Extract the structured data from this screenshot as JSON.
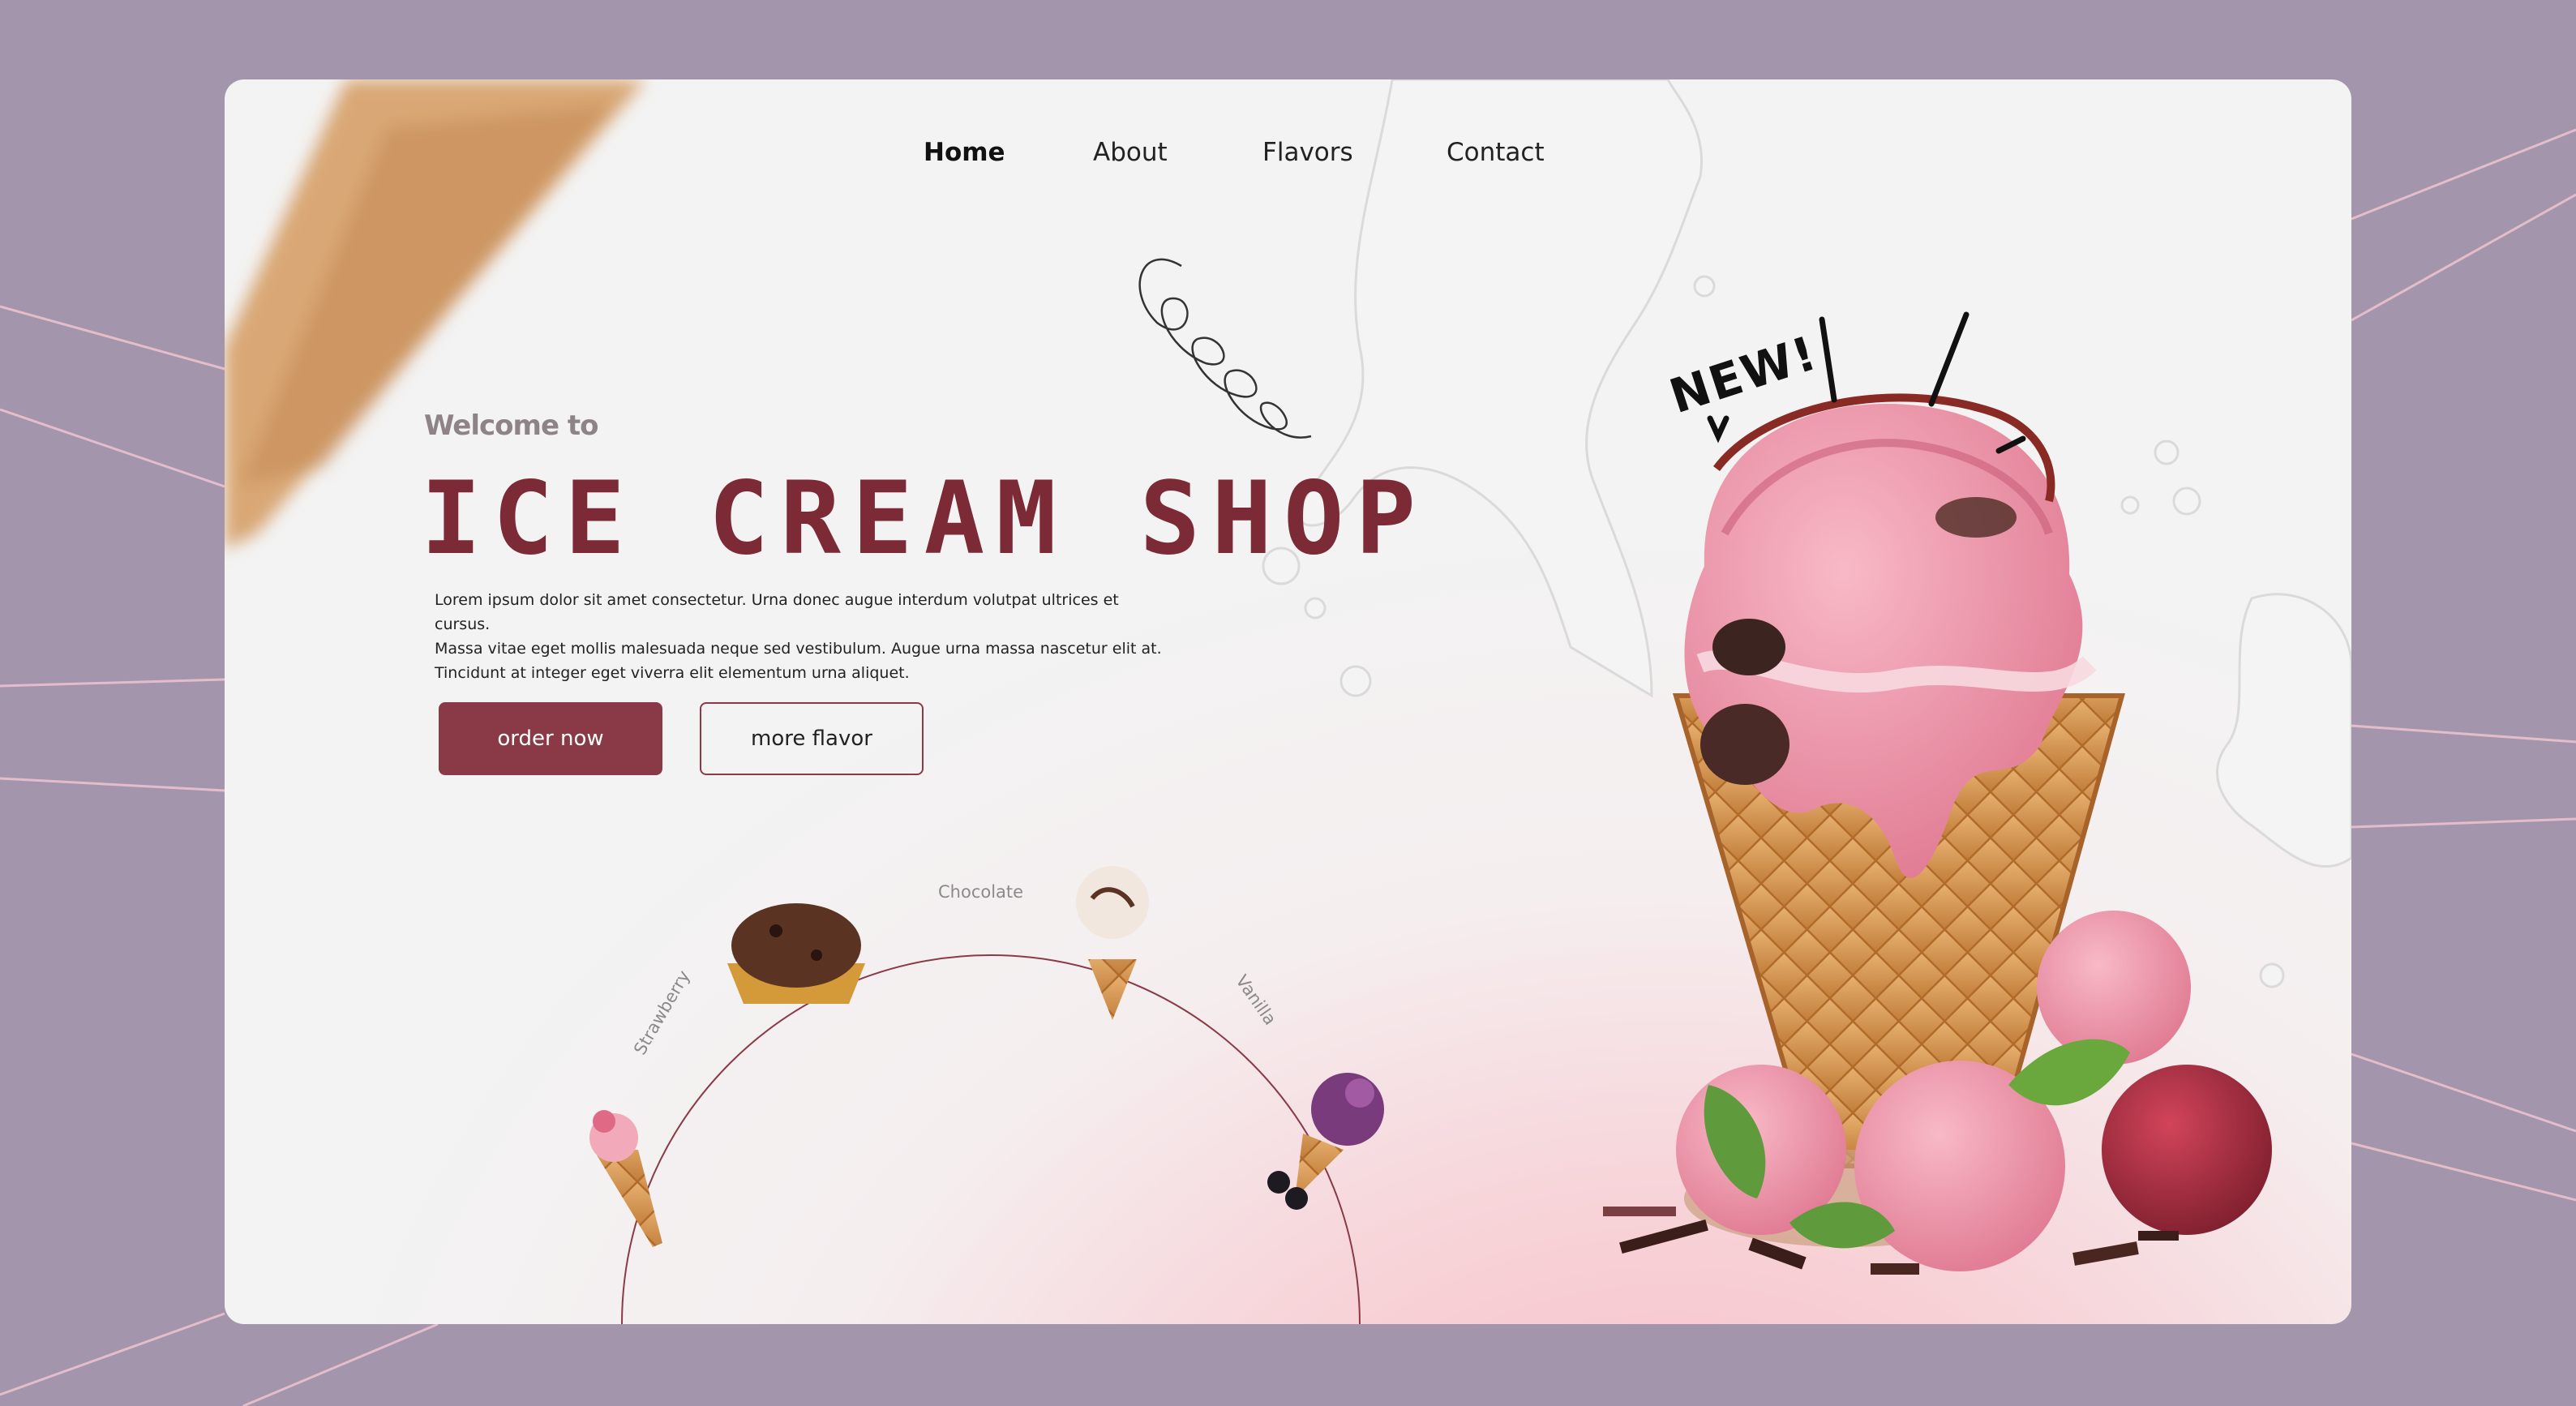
{
  "nav": {
    "items": [
      {
        "label": "Home",
        "active": true
      },
      {
        "label": "About",
        "active": false
      },
      {
        "label": "Flavors",
        "active": false
      },
      {
        "label": "Contact",
        "active": false
      }
    ]
  },
  "hero": {
    "welcome": "Welcome to",
    "title": "ICE CREAM SHOP",
    "description_lines": [
      "Lorem ipsum dolor sit amet consectetur. Urna donec augue interdum volutpat ultrices et cursus.",
      "Massa vitae eget mollis malesuada neque sed vestibulum. Augue urna massa nascetur elit at.",
      "Tincidunt at integer eget viverra elit elementum urna aliquet."
    ],
    "order_button": "order now",
    "more_button": "more flavor"
  },
  "flavor_arc": {
    "labels": [
      "Strawberry",
      "Chocolate",
      "Vanilla"
    ]
  },
  "badge": {
    "new": "NEW!"
  },
  "colors": {
    "page_background": "#a396ac",
    "brand": "#7c2a35",
    "button": "#8a3a47"
  }
}
